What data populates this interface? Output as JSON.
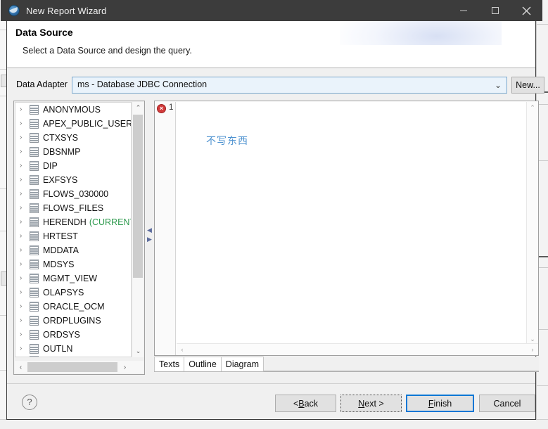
{
  "window": {
    "title": "New Report Wizard",
    "icon": "jasper-globe-icon",
    "minimize_label": "Minimize",
    "maximize_label": "Maximize",
    "close_label": "Close"
  },
  "header": {
    "title": "Data Source",
    "subtitle": "Select a Data Source and design the query."
  },
  "adapter": {
    "label": "Data Adapter",
    "value": "ms - Database JDBC Connection",
    "chevron": "⌄",
    "new_button": "New..."
  },
  "tree": {
    "items": [
      {
        "label": "ANONYMOUS",
        "suffix": ""
      },
      {
        "label": "APEX_PUBLIC_USER",
        "suffix": ""
      },
      {
        "label": "CTXSYS",
        "suffix": ""
      },
      {
        "label": "DBSNMP",
        "suffix": ""
      },
      {
        "label": "DIP",
        "suffix": ""
      },
      {
        "label": "EXFSYS",
        "suffix": ""
      },
      {
        "label": "FLOWS_030000",
        "suffix": ""
      },
      {
        "label": "FLOWS_FILES",
        "suffix": ""
      },
      {
        "label": "HERENDH",
        "suffix": "(CURRENT"
      },
      {
        "label": "HRTEST",
        "suffix": ""
      },
      {
        "label": "MDDATA",
        "suffix": ""
      },
      {
        "label": "MDSYS",
        "suffix": ""
      },
      {
        "label": "MGMT_VIEW",
        "suffix": ""
      },
      {
        "label": "OLAPSYS",
        "suffix": ""
      },
      {
        "label": "ORACLE_OCM",
        "suffix": ""
      },
      {
        "label": "ORDPLUGINS",
        "suffix": ""
      },
      {
        "label": "ORDSYS",
        "suffix": ""
      },
      {
        "label": "OUTLN",
        "suffix": ""
      },
      {
        "label": "OWBSYS",
        "suffix": ""
      }
    ],
    "twisty": "›",
    "scroll_up": "⌃",
    "scroll_down": "⌄",
    "scroll_left": "‹",
    "scroll_right": "›",
    "current_color": "#2e9a4e"
  },
  "splitter": {
    "arrow_left": "◀",
    "arrow_right": "▶"
  },
  "query": {
    "line_number": "1",
    "error_glyph": "×",
    "text": "不写东西",
    "text_color": "#4f93d0",
    "scroll_up": "⌃",
    "scroll_down": "⌄",
    "scroll_left": "‹",
    "scroll_right": "›"
  },
  "tabs": [
    {
      "label": "Texts",
      "active": true
    },
    {
      "label": "Outline",
      "active": false
    },
    {
      "label": "Diagram",
      "active": false
    }
  ],
  "footer": {
    "help": "?",
    "back": "< Back",
    "back_mnemonic": "B",
    "next": "Next >",
    "next_mnemonic": "N",
    "finish": "Finish",
    "finish_mnemonic": "F",
    "cancel": "Cancel",
    "default_button_color": "#0a77d5"
  }
}
